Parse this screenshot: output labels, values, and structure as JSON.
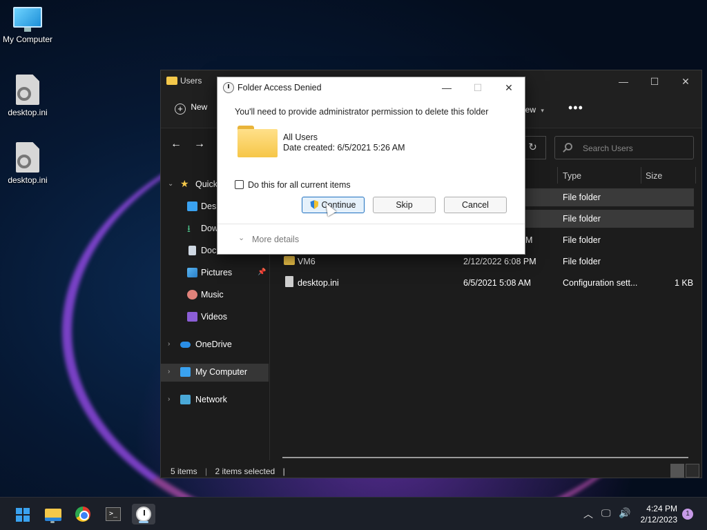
{
  "desktop": {
    "icons": [
      {
        "label": "My Computer",
        "icon": "monitor-icon"
      },
      {
        "label": "desktop.ini",
        "icon": "settings-file-icon"
      },
      {
        "label": "desktop.ini",
        "icon": "settings-file-icon"
      }
    ]
  },
  "explorer": {
    "title": "Users",
    "toolbar": {
      "new_label": "New",
      "view_label": "iew",
      "more_label": "•••"
    },
    "search_placeholder": "Search Users",
    "nav": {
      "quick_access": "Quick",
      "desktop": "Desk",
      "downloads": "Dow",
      "documents": "Doc",
      "pictures": "Pictures",
      "music": "Music",
      "videos": "Videos",
      "onedrive": "OneDrive",
      "my_computer": "My Computer",
      "network": "Network"
    },
    "columns": {
      "type": "Type",
      "size": "Size"
    },
    "rows": [
      {
        "name": "",
        "date": "",
        "type": "File folder",
        "size": ""
      },
      {
        "name": "",
        "date": "",
        "type": "File folder",
        "size": ""
      },
      {
        "name": "",
        "date": "M",
        "type": "File folder",
        "size": ""
      },
      {
        "name": "VM6",
        "date": "2/12/2022 6:08 PM",
        "type": "File folder",
        "size": ""
      },
      {
        "name": "desktop.ini",
        "date": "6/5/2021 5:08 AM",
        "type": "Configuration sett...",
        "size": "1 KB"
      }
    ],
    "status": {
      "items": "5 items",
      "selected": "2 items selected"
    }
  },
  "dialog": {
    "title": "Folder Access Denied",
    "message": "You'll need to provide administrator permission to delete this folder",
    "item_name": "All Users",
    "item_date": "Date created: 6/5/2021 5:26 AM",
    "checkbox_label": "Do this for all current items",
    "continue_label": "Continue",
    "skip_label": "Skip",
    "cancel_label": "Cancel",
    "more_details": "More details"
  },
  "taskbar": {
    "time": "4:24 PM",
    "date": "2/12/2023",
    "notification_count": "1"
  },
  "colors": {
    "accent": "#1d6fbf",
    "folder": "#f4c84a"
  }
}
